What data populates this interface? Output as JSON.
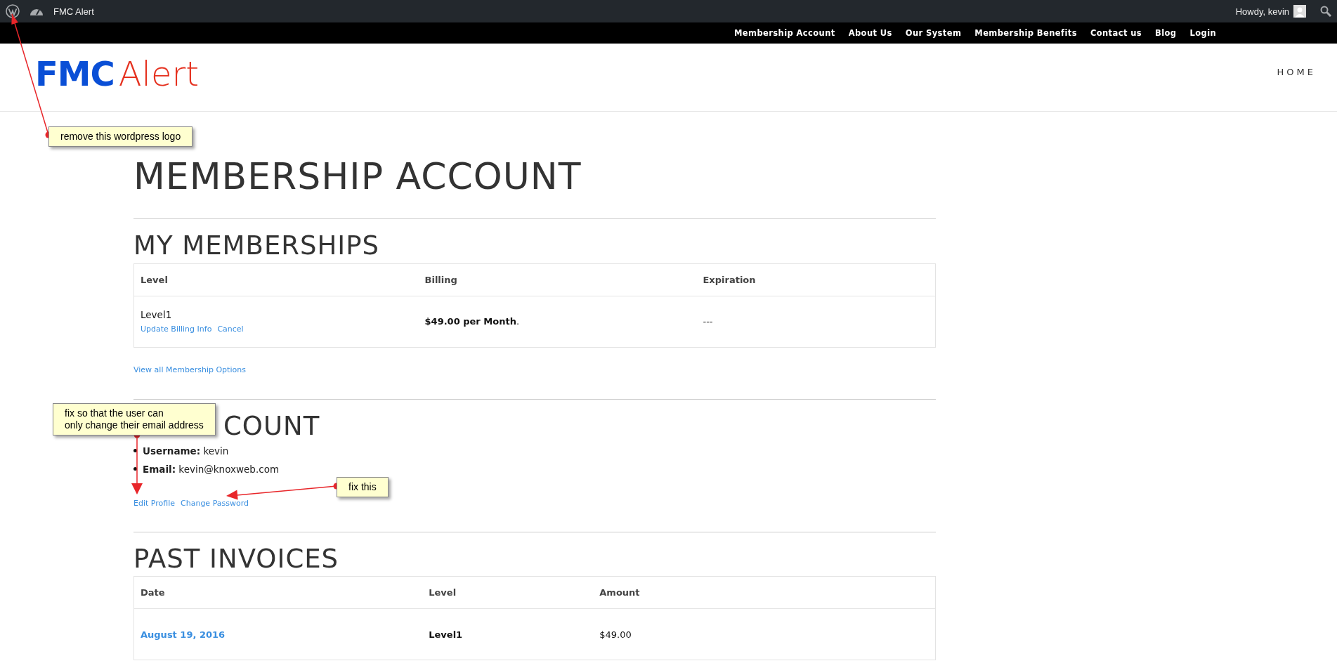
{
  "admin_bar": {
    "site_title": "FMC Alert",
    "greeting": "Howdy, kevin"
  },
  "nav": {
    "items": [
      "Membership Account",
      "About Us",
      "Our System",
      "Membership Benefits",
      "Contact us",
      "Blog",
      "Login"
    ]
  },
  "header": {
    "logo_first": "FMC",
    "logo_second": "Alert",
    "menu": "HOME"
  },
  "page_title": "MEMBERSHIP ACCOUNT",
  "memberships": {
    "heading": "MY MEMBERSHIPS",
    "columns": [
      "Level",
      "Billing",
      "Expiration"
    ],
    "rows": [
      {
        "level": "Level1",
        "actions": [
          "Update Billing Info",
          "Cancel"
        ],
        "billing": "**$49.00 per Month**.",
        "expiration": "---"
      }
    ],
    "view_all": "View all Membership Options"
  },
  "account": {
    "heading": "COUNT",
    "fields": [
      {
        "label": "Username:",
        "value": "kevin"
      },
      {
        "label": "Email:",
        "value": "kevin@knoxweb.com"
      }
    ],
    "links": [
      "Edit Profile",
      "Change Password"
    ]
  },
  "invoices": {
    "heading": "PAST INVOICES",
    "columns": [
      "Date",
      "Level",
      "Amount"
    ],
    "rows": [
      {
        "date": "August 19, 2016",
        "level": "Level1",
        "amount": "$49.00"
      }
    ]
  },
  "annotations": [
    {
      "text": "remove this wordpress logo"
    },
    {
      "text": "fix so that the user can\nonly change their email address"
    },
    {
      "text": "fix this"
    }
  ]
}
